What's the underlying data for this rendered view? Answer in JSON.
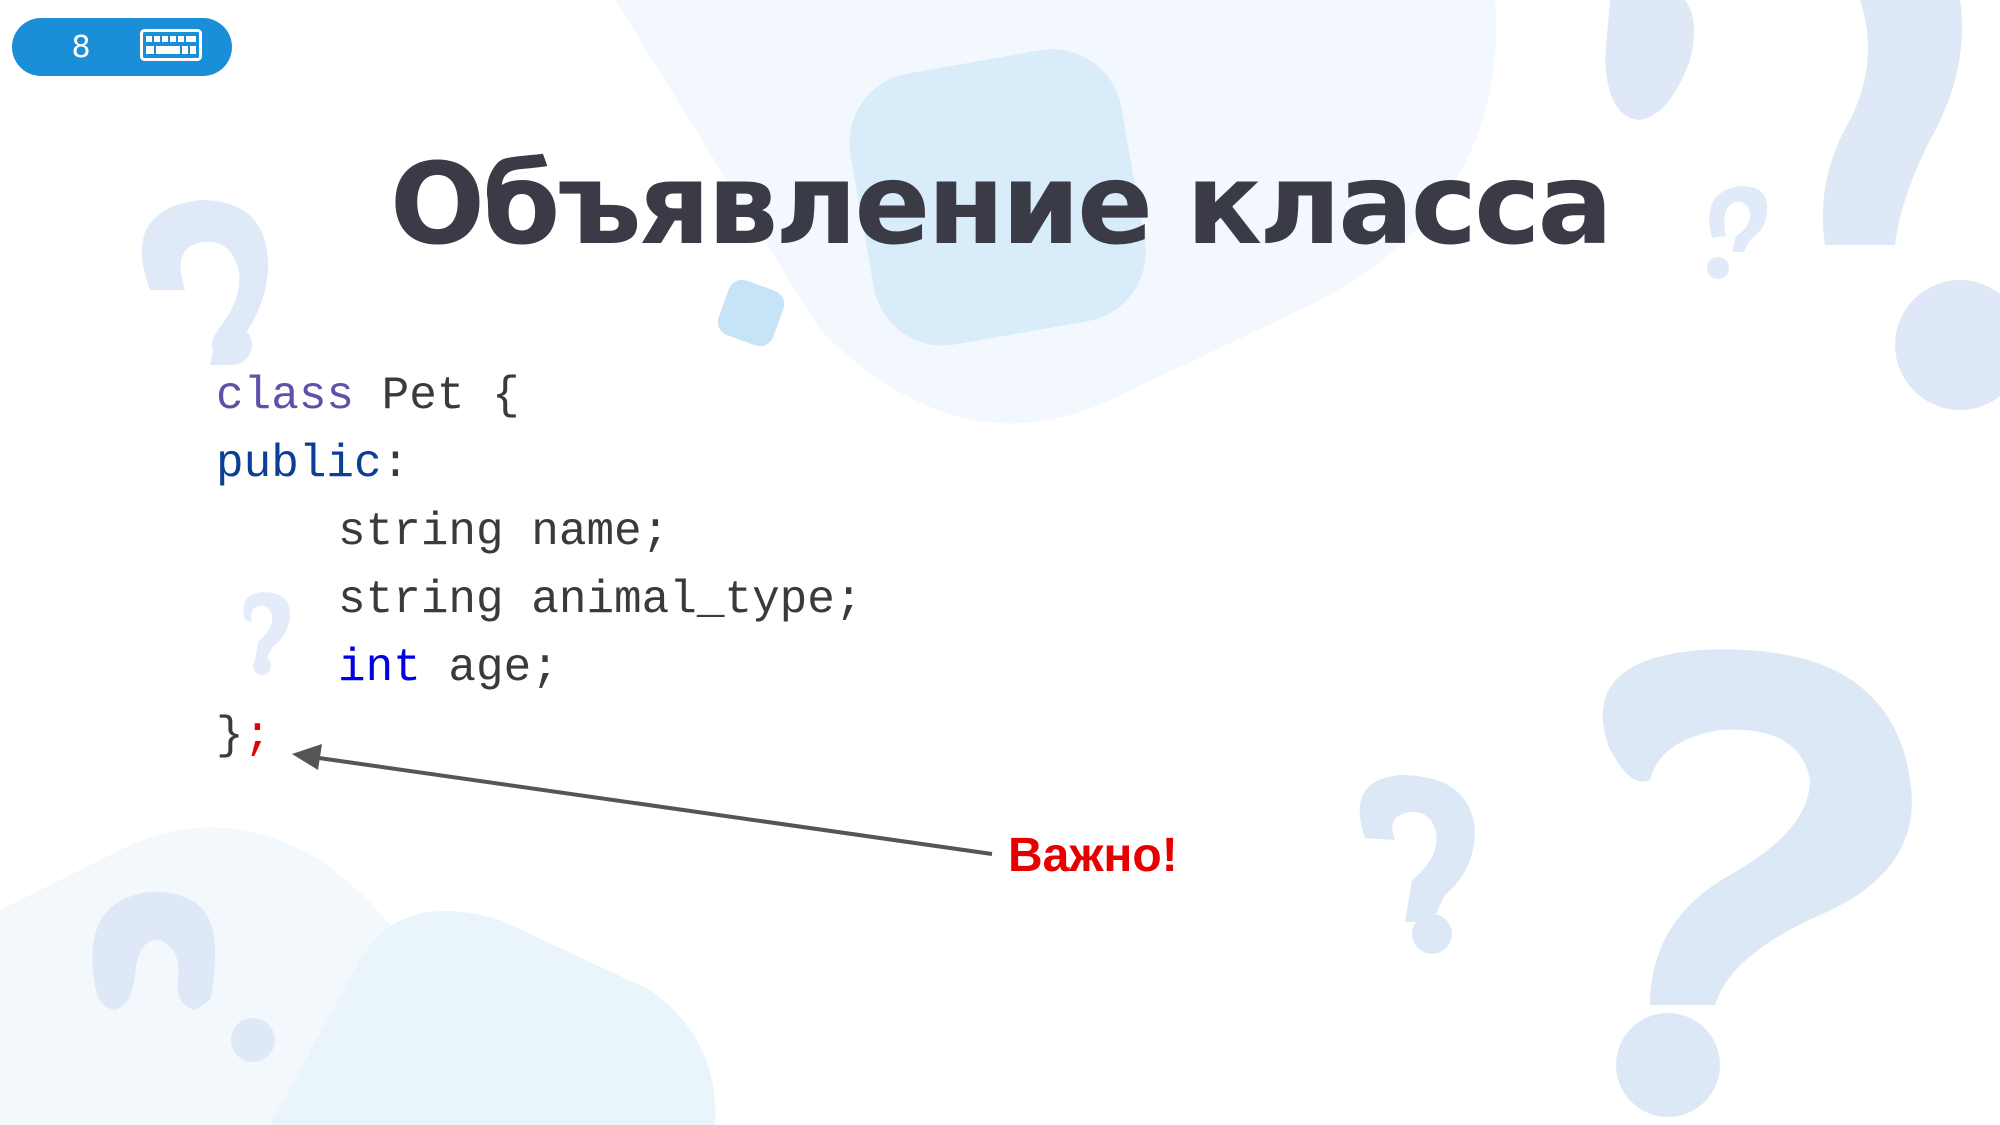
{
  "slide": {
    "page_number": "8",
    "title": "Объявление класса",
    "callout": "Важно!"
  },
  "code": {
    "kw_class": "class",
    "class_name": " Pet {",
    "kw_public": "public",
    "colon": ":",
    "line3": "string name;",
    "line4": "string animal_type;",
    "kw_int": "int",
    "line5_rest": " age;",
    "closing_brace": "}",
    "semicolon": ";"
  },
  "colors": {
    "badge": "#1a8fd8",
    "title": "#3b3b47",
    "keyword_public": "#0b3f94",
    "keyword_class": "#5e52a8",
    "keyword_int": "#0000e0",
    "accent_red": "#e80000",
    "decor_blue": "#dde8f7"
  },
  "icons": [
    "keyboard-icon",
    "question-mark-icon",
    "arrow-icon"
  ]
}
